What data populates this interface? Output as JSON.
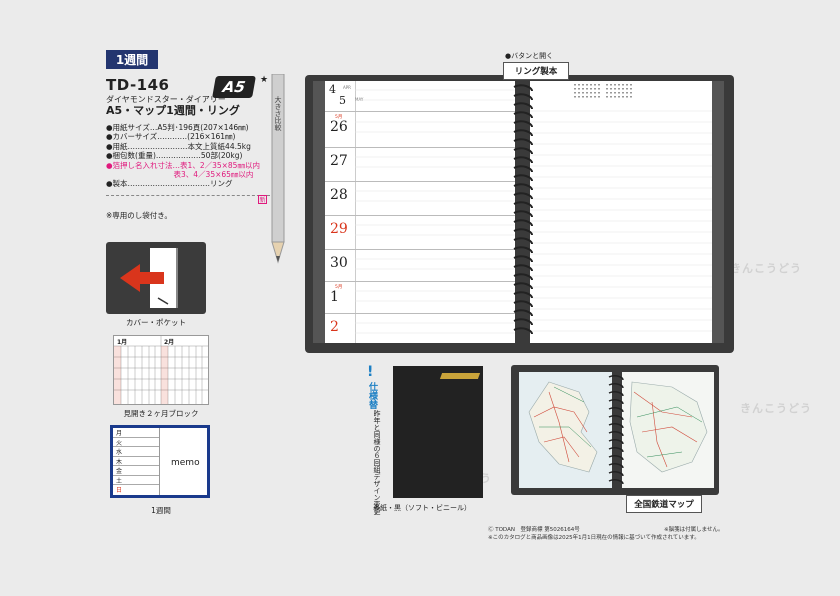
{
  "category_label": "1週間",
  "product": {
    "code": "TD-146",
    "size_badge": "A5",
    "star": "★",
    "series": "ダイヤモンドスター・ダイアリー",
    "name": "A5・マップ1週間・リング"
  },
  "specs": [
    {
      "text": "●用紙サイズ…A5判･196頁(207×146㎜)",
      "highlight": false
    },
    {
      "text": "●カバーサイズ…………(216×161㎜)",
      "highlight": false
    },
    {
      "text": "●用紙……………………本文上質紙44.5kg",
      "highlight": false
    },
    {
      "text": "●梱包数(重量)………………50部(20kg)",
      "highlight": false
    },
    {
      "text": "●箔押し名入れ寸法…表1、2／35×85㎜以内",
      "highlight": true
    },
    {
      "text": "　　　　　　　　　表3、4／35×65㎜以内",
      "highlight": true
    },
    {
      "text": "●製本……………………………リング",
      "highlight": false
    }
  ],
  "new_mark": "新",
  "noshi_note": "※専用のし袋付き。",
  "pencil_label": "大きさ比較",
  "thumbnails": {
    "cover_label": "カバー・ポケット",
    "calendar_label": "見開き２ヶ月ブロック",
    "calendar_months": [
      "1月",
      "2月"
    ],
    "week_label": "1週間",
    "week_days": [
      "月",
      "火",
      "水",
      "木",
      "金",
      "土",
      "日"
    ],
    "week_memo": "memo"
  },
  "planner": {
    "pull_tag": "●バタンと開く",
    "ring_label": "リング製本",
    "month_top": "4",
    "month_top_en": "APR",
    "day_top": "5",
    "day_top_en": "MAY",
    "days": [
      {
        "month": "",
        "num": "",
        "color": "#222"
      },
      {
        "month": "5月",
        "num": "26",
        "color": "#222"
      },
      {
        "month": "",
        "num": "27",
        "color": "#222"
      },
      {
        "month": "",
        "num": "28",
        "color": "#222"
      },
      {
        "month": "",
        "num": "29",
        "color": "#d9351c"
      },
      {
        "month": "",
        "num": "30",
        "color": "#222"
      },
      {
        "month": "5月",
        "num": "1",
        "color": "#222"
      },
      {
        "month": "",
        "num": "2",
        "color": "#d9351c"
      }
    ]
  },
  "bottom": {
    "spec_change_title": "仕様替",
    "design_note": "昨年と同様の６回組デザイン変更",
    "cover_label": "表紙・黒（ソフト・ビニール）",
    "map_label": "全国鉄道マップ",
    "copyright": "Ⓒ TODAN　登録商標 第5026164号",
    "catalog_note": "※このカタログと商品画像は2025年1月1日現在の情報に基づいて作成されています。",
    "bag_note": "※脳箋は付属しません。"
  },
  "watermark_text": "きんこうどう",
  "colors": {
    "navy": "#23356f",
    "pink": "#e0197d",
    "red": "#d9351c"
  }
}
